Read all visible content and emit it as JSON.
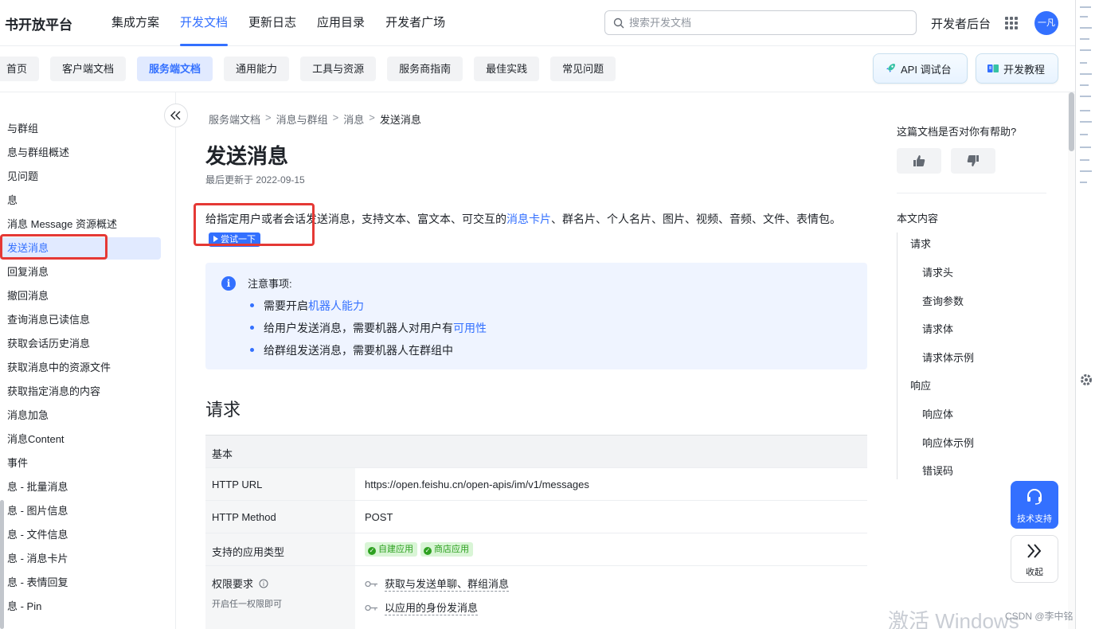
{
  "header": {
    "brand": "书开放平台",
    "nav": [
      "集成方案",
      "开发文档",
      "更新日志",
      "应用目录",
      "开发者广场"
    ],
    "active_nav": "开发文档",
    "search_placeholder": "搜索开发文档",
    "dev_console": "开发者后台",
    "avatar_text": "一凡"
  },
  "subnav": {
    "tabs": [
      "首页",
      "客户端文档",
      "服务端文档",
      "通用能力",
      "工具与资源",
      "服务商指南",
      "最佳实践",
      "常见问题"
    ],
    "active_tab": "服务端文档",
    "api_console": "API 调试台",
    "dev_tutorial": "开发教程"
  },
  "sidebar": {
    "items": [
      "与群组",
      "息与群组概述",
      "见问题",
      "息",
      "消息 Message 资源概述",
      "发送消息",
      "回复消息",
      "撤回消息",
      "查询消息已读信息",
      "获取会话历史消息",
      "获取消息中的资源文件",
      "获取指定消息的内容",
      "消息加急",
      "消息Content",
      "事件",
      "息 - 批量消息",
      "息 - 图片信息",
      "息 - 文件信息",
      "息 - 消息卡片",
      "息 - 表情回复",
      "息 - Pin"
    ],
    "active_index": 5
  },
  "breadcrumb": [
    "服务端文档",
    "消息与群组",
    "消息",
    "发送消息"
  ],
  "article": {
    "title": "发送消息",
    "updated": "最后更新于 2022-09-15",
    "intro_prefix": "给指定用户或者会话发送消息，支持文本、富文本、可交互的",
    "intro_link": "消息卡片",
    "intro_suffix": "、群名片、个人名片、图片、视频、音频、文件、表情包。",
    "try_button": "尝试一下",
    "notice": {
      "title": "注意事项:",
      "item1_prefix": "需要开启",
      "item1_link": "机器人能力",
      "item2_prefix": "给用户发送消息，需要机器人对用户有",
      "item2_link": "可用性",
      "item3": "给群组发送消息，需要机器人在群组中"
    },
    "section_request": "请求",
    "table": {
      "head": "基本",
      "url_label": "HTTP URL",
      "url_value": "https://open.feishu.cn/open-apis/im/v1/messages",
      "method_label": "HTTP Method",
      "method_value": "POST",
      "app_type_label": "支持的应用类型",
      "app_types": [
        "自建应用",
        "商店应用"
      ],
      "perm_label": "权限要求",
      "perm_note": "开启任一权限即可",
      "perms": [
        "获取与发送单聊、群组消息",
        "以应用的身份发消息"
      ]
    }
  },
  "right_panel": {
    "helpful_question": "这篇文档是否对你有帮助?",
    "toc_title": "本文内容",
    "toc": [
      "请求",
      "请求头",
      "查询参数",
      "请求体",
      "请求体示例",
      "响应",
      "响应体",
      "响应体示例",
      "错误码"
    ],
    "tech_support": "技术支持",
    "collapse": "收起"
  },
  "overlay": {
    "watermark": "激活 Windows",
    "csdn": "CSDN @李中铭"
  },
  "colors": {
    "accent": "#3370ff",
    "highlight_box": "#e53935",
    "tag_green": "#2ea121"
  }
}
